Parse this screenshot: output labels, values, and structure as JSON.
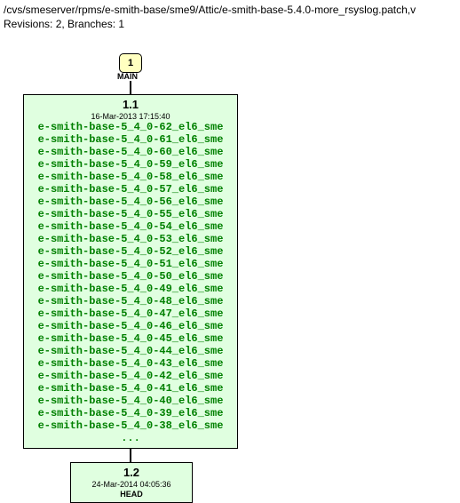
{
  "header": {
    "path": "/cvs/smeserver/rpms/e-smith-base/sme9/Attic/e-smith-base-5.4.0-more_rsyslog.patch,v",
    "stats": "Revisions: 2, Branches: 1"
  },
  "main_node": {
    "label": "1",
    "caption": "MAIN"
  },
  "rev1": {
    "version": "1.1",
    "date": "16-Mar-2013 17:15:40",
    "items": [
      "e-smith-base-5_4_0-62_el6_sme",
      "e-smith-base-5_4_0-61_el6_sme",
      "e-smith-base-5_4_0-60_el6_sme",
      "e-smith-base-5_4_0-59_el6_sme",
      "e-smith-base-5_4_0-58_el6_sme",
      "e-smith-base-5_4_0-57_el6_sme",
      "e-smith-base-5_4_0-56_el6_sme",
      "e-smith-base-5_4_0-55_el6_sme",
      "e-smith-base-5_4_0-54_el6_sme",
      "e-smith-base-5_4_0-53_el6_sme",
      "e-smith-base-5_4_0-52_el6_sme",
      "e-smith-base-5_4_0-51_el6_sme",
      "e-smith-base-5_4_0-50_el6_sme",
      "e-smith-base-5_4_0-49_el6_sme",
      "e-smith-base-5_4_0-48_el6_sme",
      "e-smith-base-5_4_0-47_el6_sme",
      "e-smith-base-5_4_0-46_el6_sme",
      "e-smith-base-5_4_0-45_el6_sme",
      "e-smith-base-5_4_0-44_el6_sme",
      "e-smith-base-5_4_0-43_el6_sme",
      "e-smith-base-5_4_0-42_el6_sme",
      "e-smith-base-5_4_0-41_el6_sme",
      "e-smith-base-5_4_0-40_el6_sme",
      "e-smith-base-5_4_0-39_el6_sme",
      "e-smith-base-5_4_0-38_el6_sme"
    ],
    "dots": "..."
  },
  "rev2": {
    "version": "1.2",
    "date": "24-Mar-2014 04:05:36",
    "head": "HEAD"
  }
}
